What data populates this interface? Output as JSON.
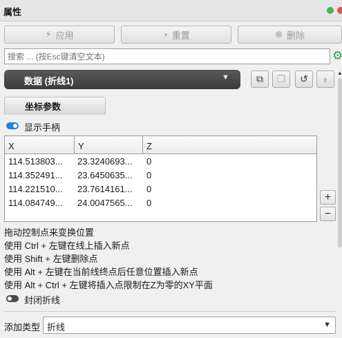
{
  "window": {
    "title": "属性"
  },
  "toolbar": {
    "apply_label": "应用",
    "reset_label": "重置",
    "delete_label": "删除"
  },
  "search": {
    "placeholder": "搜索 ... (按Esc键清空文本)"
  },
  "object_selector": {
    "selected": "数据 (折线1)"
  },
  "tabs": [
    {
      "label": "坐标参数"
    }
  ],
  "show_handle": {
    "label": "显示手柄",
    "on": true
  },
  "points_table": {
    "columns": [
      "X",
      "Y",
      "Z"
    ],
    "rows": [
      [
        "114.513803...",
        "23.3240693...",
        "0"
      ],
      [
        "114.352491...",
        "23.6450635...",
        "0"
      ],
      [
        "114.221510...",
        "23.7614161...",
        "0"
      ],
      [
        "114.084749...",
        "24.0047565...",
        "0"
      ]
    ]
  },
  "buttons": {
    "plus": "+",
    "minus": "−"
  },
  "hints": [
    "拖动控制点来变换位置",
    "使用 Ctrl + 左键在线上插入新点",
    "使用 Shift + 左键删除点",
    "使用 Alt + 左键在当前线终点后任意位置插入新点",
    "使用 Alt + Ctrl + 左键将插入点限制在Z为零的XY平面"
  ],
  "close_polyline": {
    "label": "封闭折线",
    "on": false
  },
  "add_type": {
    "label": "添加类型",
    "value": "折线"
  },
  "colors": {
    "accent": "#2a7ddb",
    "toolbar_text_disabled": "#9a9a9a",
    "selector_bg": "#4a4a4a"
  }
}
